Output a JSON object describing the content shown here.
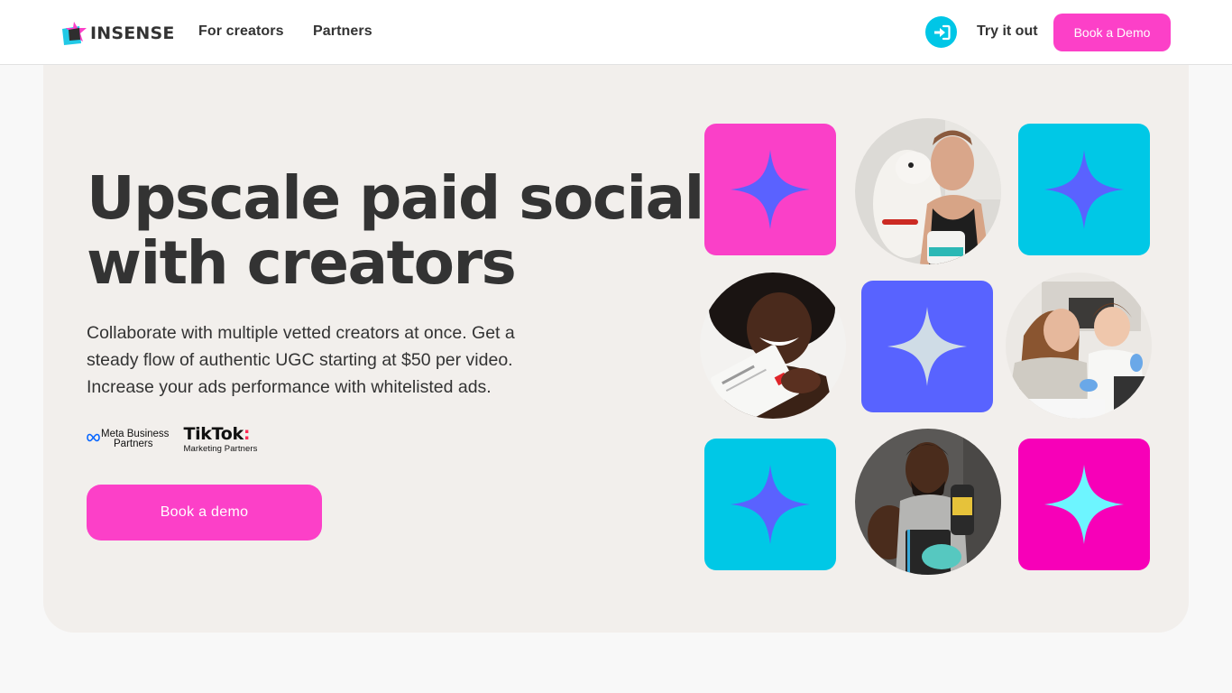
{
  "header": {
    "brand": "INSENSE",
    "nav": [
      {
        "label": "For creators"
      },
      {
        "label": "Partners"
      }
    ],
    "login_icon": "sign-in-icon",
    "try_label": "Try it out",
    "book_demo_label": "Book a Demo"
  },
  "hero": {
    "title_line1": "Upscale paid social",
    "title_line2": "with creators",
    "subtitle": "Collaborate with multiple vetted creators at once. Get a steady flow of authentic UGC starting at $50 per video. Increase your ads performance with whitelisted ads.",
    "partners": {
      "meta_line1": "Meta Business",
      "meta_line2": "Partners",
      "tiktok_word": "TikTok",
      "tiktok_sub": "Marketing Partners"
    },
    "cta_label": "Book a demo"
  },
  "grid": {
    "tiles": [
      {
        "name": "pink-star-tile",
        "bg": "#fa40c8",
        "star": "#5a62ff"
      },
      {
        "name": "cyan-star-tile",
        "bg": "#00c8e6",
        "star": "#5a62ff"
      },
      {
        "name": "blue-star-tile",
        "bg": "#5863ff",
        "star": "#cfdce6"
      },
      {
        "name": "cyan-star-tile-2",
        "bg": "#00c8e6",
        "star": "#5a62ff"
      },
      {
        "name": "magenta-star-tile",
        "bg": "#f700b8",
        "star": "#6df5ff"
      }
    ],
    "photos": [
      {
        "name": "creator-photo-woman-with-dog"
      },
      {
        "name": "creator-photo-woman-with-product"
      },
      {
        "name": "creator-photo-mother-and-son"
      },
      {
        "name": "creator-photo-man-with-products"
      }
    ]
  },
  "colors": {
    "accent_pink": "#fc40c8",
    "accent_cyan": "#00c6e6",
    "text_dark": "#333333",
    "hero_bg": "#f2efec"
  }
}
